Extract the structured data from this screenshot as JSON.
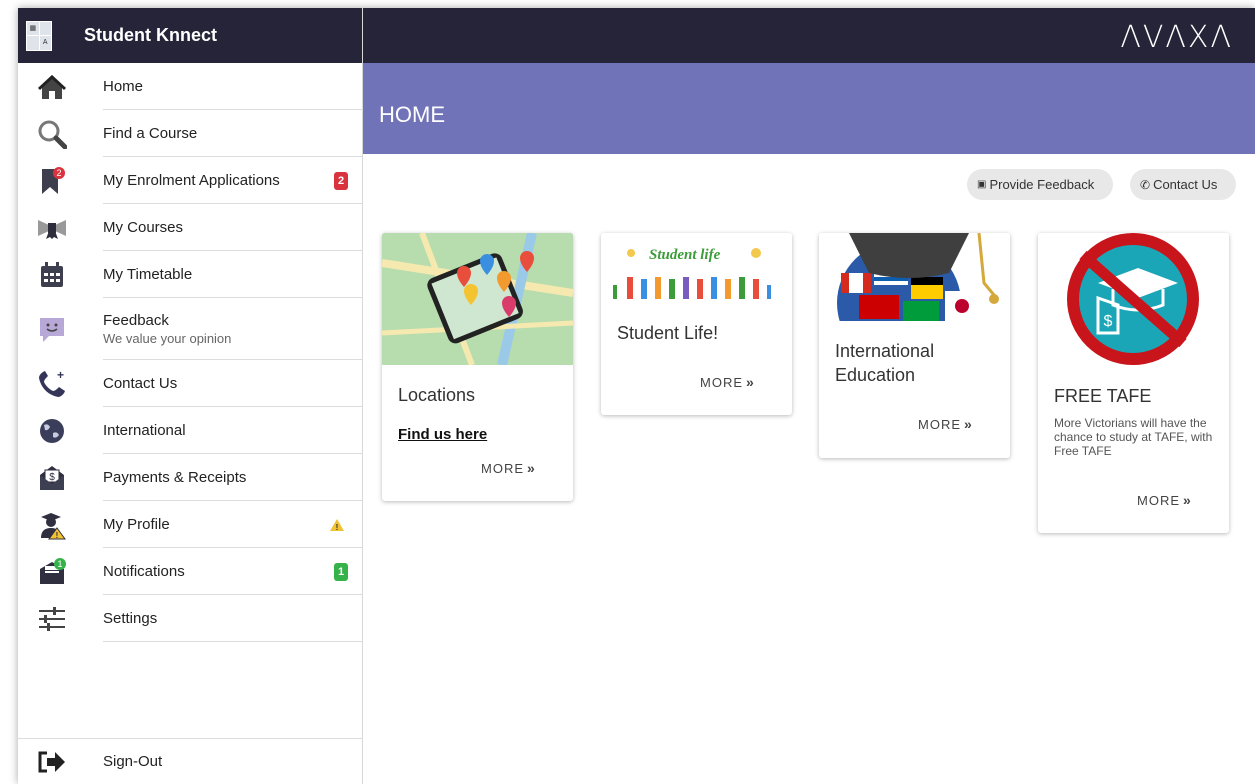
{
  "app": {
    "name": "Student Knnect",
    "company_logo": "ΛVΛXΛ"
  },
  "sidebar": {
    "items": [
      {
        "label": "Home",
        "icon": "home-icon"
      },
      {
        "label": "Find a Course",
        "icon": "search-icon"
      },
      {
        "label": "My Enrolment Applications",
        "icon": "bookmark-icon",
        "badge": "2"
      },
      {
        "label": "My Courses",
        "icon": "bowtie-icon"
      },
      {
        "label": "My Timetable",
        "icon": "calendar-icon"
      },
      {
        "label": "Feedback",
        "sublabel": "We value your opinion",
        "icon": "feedback-icon"
      },
      {
        "label": "Contact Us",
        "icon": "phone-icon"
      },
      {
        "label": "International",
        "icon": "globe-icon"
      },
      {
        "label": "Payments & Receipts",
        "icon": "payment-icon"
      },
      {
        "label": "My Profile",
        "icon": "profile-icon",
        "badge": "!"
      },
      {
        "label": "Notifications",
        "icon": "notification-icon",
        "badge": "1"
      },
      {
        "label": "Settings",
        "icon": "settings-icon"
      }
    ],
    "signout": {
      "label": "Sign-Out",
      "icon": "signout-icon"
    }
  },
  "header": {
    "title": "HOME"
  },
  "actions": {
    "feedback": "Provide Feedback",
    "contact": "Contact Us"
  },
  "cards": [
    {
      "title": "Locations",
      "link": "Find us here",
      "more": "MORE"
    },
    {
      "title": "Student Life!",
      "image_text": "Student life",
      "more": "MORE"
    },
    {
      "title": "International Education",
      "more": "MORE"
    },
    {
      "title": "FREE TAFE",
      "description": "More Victorians will have the chance to study at TAFE, with Free TAFE",
      "more": "MORE"
    }
  ],
  "colors": {
    "dark": "#262438",
    "header": "#7173b9",
    "badge_red": "#d9343d",
    "badge_green": "#36b24a"
  }
}
